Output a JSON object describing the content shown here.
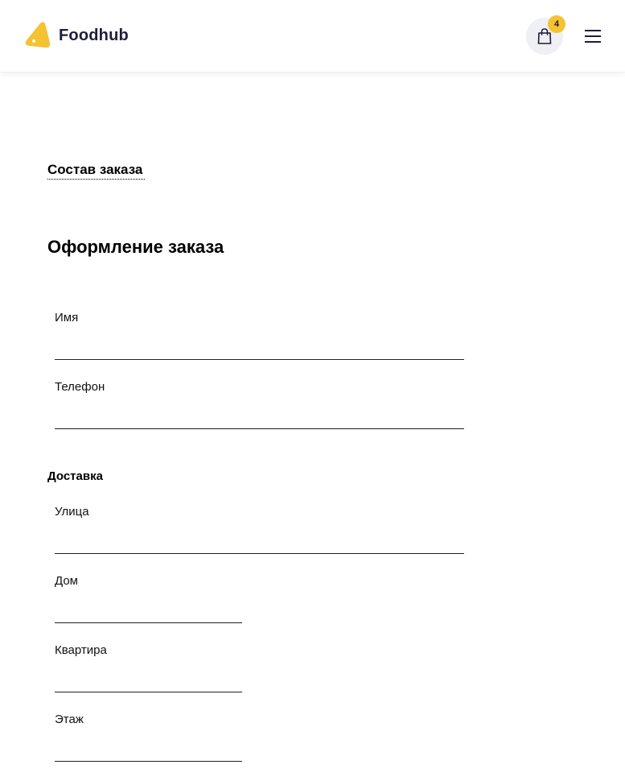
{
  "header": {
    "logo_text": "Foodhub",
    "cart_count": "4",
    "colors": {
      "accent": "#f5c231",
      "brand_text": "#1f1c3a",
      "cart_bg": "#eef0f3"
    },
    "icons": [
      "logo-icon",
      "shopping-bag-icon",
      "hamburger-menu-icon"
    ]
  },
  "order": {
    "summary_link": "Состав заказа",
    "title": "Оформление заказа"
  },
  "contact": {
    "name_label": "Имя",
    "name_value": "",
    "phone_label": "Телефон",
    "phone_value": ""
  },
  "delivery": {
    "title": "Доставка",
    "street_label": "Улица",
    "street_value": "",
    "house_label": "Дом",
    "house_value": "",
    "apartment_label": "Квартира",
    "apartment_value": "",
    "floor_label": "Этаж",
    "floor_value": ""
  }
}
